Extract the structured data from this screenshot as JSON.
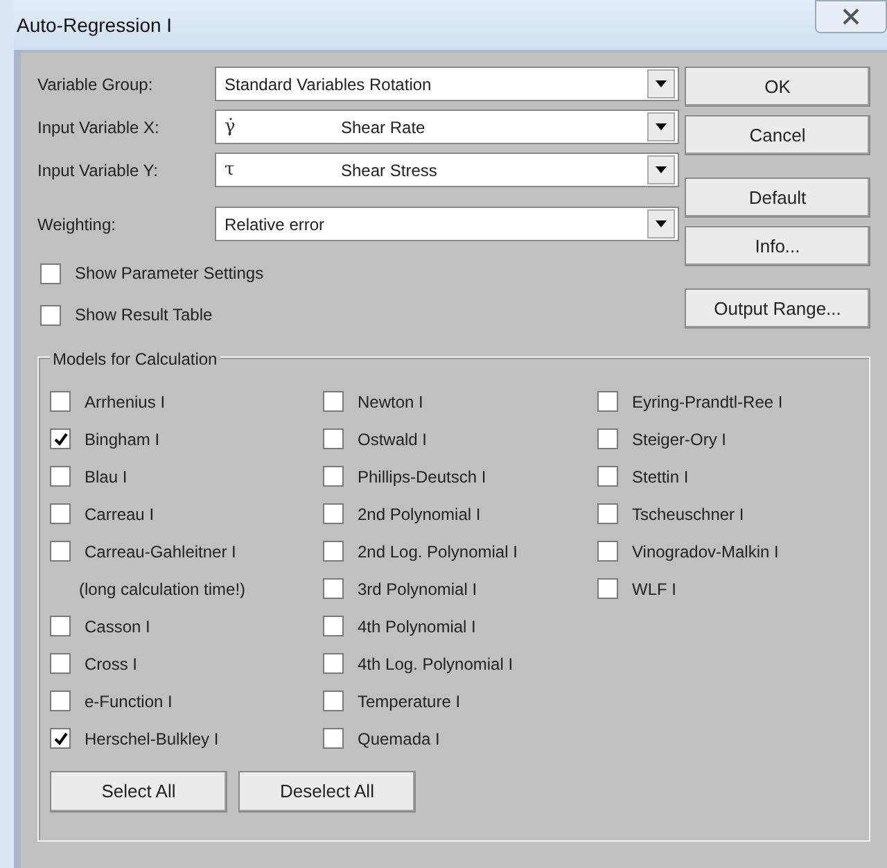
{
  "window": {
    "title": "Auto-Regression I"
  },
  "fields": [
    {
      "label": "Variable Group:",
      "value": "Standard Variables Rotation"
    },
    {
      "label": "Input Variable X:",
      "symbol": "γ̇",
      "value": "Shear Rate"
    },
    {
      "label": "Input Variable Y:",
      "symbol": "τ",
      "value": "Shear Stress"
    },
    {
      "label": "Weighting:",
      "value": "Relative error"
    }
  ],
  "options": [
    {
      "label": "Show Parameter Settings",
      "checked": false
    },
    {
      "label": "Show Result Table",
      "checked": false
    }
  ],
  "button_groups": [
    [
      "OK",
      "Cancel"
    ],
    [
      "Default",
      "Info..."
    ],
    [
      "Output Range..."
    ]
  ],
  "models": {
    "title": "Models for Calculation",
    "columns": [
      [
        {
          "kind": "checkbox",
          "label": "Arrhenius I",
          "checked": false
        },
        {
          "kind": "checkbox",
          "label": "Bingham I",
          "checked": true
        },
        {
          "kind": "checkbox",
          "label": "Blau I",
          "checked": false
        },
        {
          "kind": "checkbox",
          "label": "Carreau I",
          "checked": false
        },
        {
          "kind": "checkbox",
          "label": "Carreau-Gahleitner I",
          "checked": false
        },
        {
          "kind": "note",
          "label": "(long calculation time!)"
        },
        {
          "kind": "checkbox",
          "label": "Casson I",
          "checked": false
        },
        {
          "kind": "checkbox",
          "label": "Cross I",
          "checked": false
        },
        {
          "kind": "checkbox",
          "label": "e-Function I",
          "checked": false
        },
        {
          "kind": "checkbox",
          "label": "Herschel-Bulkley I",
          "checked": true
        }
      ],
      [
        {
          "kind": "checkbox",
          "label": "Newton I",
          "checked": false
        },
        {
          "kind": "checkbox",
          "label": "Ostwald I",
          "checked": false
        },
        {
          "kind": "checkbox",
          "label": "Phillips-Deutsch I",
          "checked": false
        },
        {
          "kind": "checkbox",
          "label": "2nd Polynomial I",
          "checked": false
        },
        {
          "kind": "checkbox",
          "label": "2nd Log. Polynomial I",
          "checked": false
        },
        {
          "kind": "checkbox",
          "label": "3rd Polynomial I",
          "checked": false
        },
        {
          "kind": "checkbox",
          "label": "4th Polynomial I",
          "checked": false
        },
        {
          "kind": "checkbox",
          "label": "4th Log. Polynomial I",
          "checked": false
        },
        {
          "kind": "checkbox",
          "label": "Temperature I",
          "checked": false
        },
        {
          "kind": "checkbox",
          "label": "Quemada I",
          "checked": false
        }
      ],
      [
        {
          "kind": "checkbox",
          "label": "Eyring-Prandtl-Ree I",
          "checked": false
        },
        {
          "kind": "checkbox",
          "label": "Steiger-Ory I",
          "checked": false
        },
        {
          "kind": "checkbox",
          "label": "Stettin I",
          "checked": false
        },
        {
          "kind": "checkbox",
          "label": "Tscheuschner I",
          "checked": false
        },
        {
          "kind": "checkbox",
          "label": "Vinogradov-Malkin I",
          "checked": false
        },
        {
          "kind": "checkbox",
          "label": "WLF I",
          "checked": false
        }
      ]
    ],
    "buttons": [
      "Select All",
      "Deselect All"
    ]
  }
}
